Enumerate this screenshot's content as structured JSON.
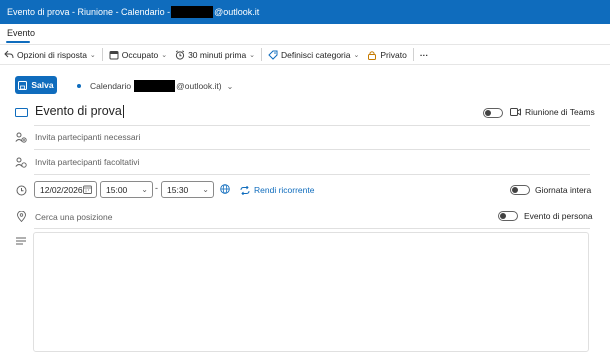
{
  "window": {
    "title_prefix": "Evento di prova - Riunione - Calendario -",
    "title_suffix": "@outlook.it"
  },
  "tabs": [
    {
      "label": "Evento",
      "active": true
    }
  ],
  "toolbar": {
    "response_options": "Opzioni di risposta",
    "busy_status": "Occupato",
    "reminder": "30 minuti prima",
    "category": "Definisci categoria",
    "private": "Privato",
    "more": "···"
  },
  "save_bar": {
    "save_label": "Salva",
    "calendar_prefix": "Calendario",
    "calendar_suffix": "@outlook.it)"
  },
  "event": {
    "title": "Evento di prova",
    "teams_label": "Riunione di Teams",
    "teams_enabled": false,
    "required_attendees_placeholder": "Invita partecipanti necessari",
    "optional_attendees_placeholder": "Invita partecipanti facoltativi",
    "date": "12/02/2026",
    "start_time": "15:00",
    "end_time": "15:30",
    "time_separator": "-",
    "recurring_label": "Rendi ricorrente",
    "all_day_label": "Giornata intera",
    "all_day_enabled": false,
    "location_placeholder": "Cerca una posizione",
    "in_person_label": "Evento di persona",
    "in_person_enabled": false
  },
  "colors": {
    "accent": "#0f6cbd",
    "title_bar": "#0f6cbd"
  }
}
